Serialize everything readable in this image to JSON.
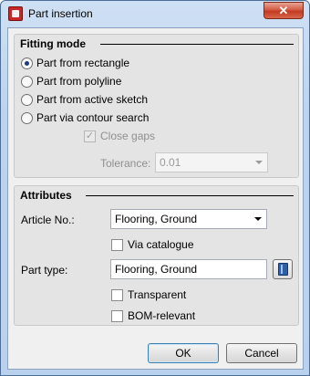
{
  "window": {
    "title": "Part insertion",
    "close_glyph": "✕"
  },
  "fitting_mode": {
    "header": "Fitting mode",
    "options": [
      {
        "label": "Part from rectangle",
        "selected": true
      },
      {
        "label": "Part from polyline",
        "selected": false
      },
      {
        "label": "Part from active sketch",
        "selected": false
      },
      {
        "label": "Part via contour search",
        "selected": false
      }
    ],
    "close_gaps": {
      "label": "Close gaps",
      "checked": true,
      "enabled": false
    },
    "tolerance": {
      "label": "Tolerance:",
      "value": "0.01",
      "enabled": false
    }
  },
  "attributes": {
    "header": "Attributes",
    "article_no": {
      "label": "Article No.:",
      "value": "Flooring, Ground"
    },
    "via_catalogue": {
      "label": "Via catalogue",
      "checked": false
    },
    "part_type": {
      "label": "Part type:",
      "value": "Flooring, Ground"
    },
    "transparent": {
      "label": "Transparent",
      "checked": false
    },
    "bom_relevant": {
      "label": "BOM-relevant",
      "checked": false
    }
  },
  "buttons": {
    "ok": "OK",
    "cancel": "Cancel"
  },
  "icons": {
    "app": "part-insertion-icon",
    "library": "catalogue-book-icon"
  }
}
